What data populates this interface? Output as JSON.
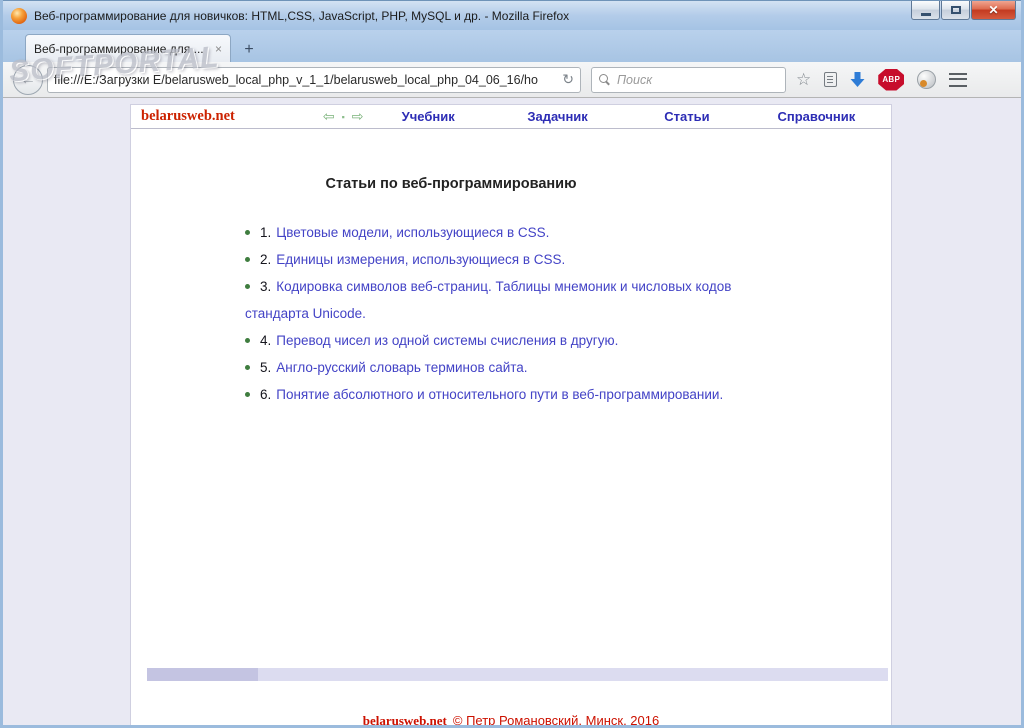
{
  "window": {
    "title": "Веб-программирование для новичков: HTML,CSS, JavaScript, PHP, MySQL и др. - Mozilla Firefox"
  },
  "tabbar": {
    "active_tab_title": "Веб-программирование для ...",
    "close_tab_glyph": "×",
    "new_tab_glyph": "+"
  },
  "toolbar": {
    "back_glyph": "←",
    "url": "file:///E:/Загрузки E/belarusweb_local_php_v_1_1/belarusweb_local_php_04_06_16/ho",
    "reload_glyph": "↻",
    "search_placeholder": "Поиск",
    "star_glyph": "☆",
    "abp_label": "ABP"
  },
  "watermark": {
    "text": "SOFTPORTAL"
  },
  "site": {
    "brand": "belarusweb.net",
    "nav_prev_glyph": "⇦",
    "nav_dot_glyph": "▪",
    "nav_next_glyph": "⇨",
    "menu": [
      "Учебник",
      "Задачник",
      "Статьи",
      "Справочник"
    ],
    "heading": "Статьи по веб-программированию",
    "articles": [
      {
        "num": "1.",
        "title": "Цветовые модели, использующиеся в CSS."
      },
      {
        "num": "2.",
        "title": "Единицы измерения, использующиеся в CSS."
      },
      {
        "num": "3.",
        "title": "Кодировка символов веб-страниц. Таблицы мнемоник и числовых кодов стандарта Unicode."
      },
      {
        "num": "4.",
        "title": "Перевод чисел из одной системы счисления в другую."
      },
      {
        "num": "5.",
        "title": "Англо-русский словарь терминов сайта."
      },
      {
        "num": "6.",
        "title": "Понятие абсолютного и относительного пути в веб-программировании."
      }
    ],
    "footer_brand": "belarusweb.net",
    "footer_copy": "© Петр Романовский, Минск, 2016"
  },
  "colors": {
    "brand_red": "#cc2200",
    "menu_blue": "#2d2db5",
    "link_blue": "#4343c6",
    "bullet_green": "#3f7d3f",
    "page_bg": "#e9e9f3",
    "titlebar_blue": "#a5c3e4",
    "abp_red": "#c70d2c",
    "download_blue": "#2e7cd6"
  }
}
